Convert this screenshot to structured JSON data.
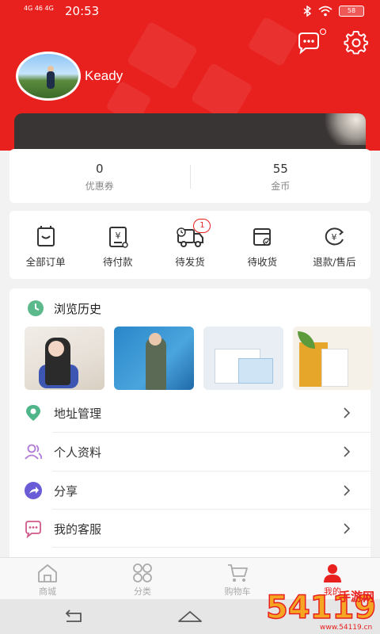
{
  "status_bar": {
    "signal": "4G 46 4G",
    "time": "20:53",
    "battery": "58"
  },
  "profile": {
    "username": "Keady"
  },
  "stats": [
    {
      "value": "0",
      "label": "优惠券"
    },
    {
      "value": "55",
      "label": "金币"
    }
  ],
  "orders": [
    {
      "label": "全部订单",
      "icon": "order-list-icon"
    },
    {
      "label": "待付款",
      "icon": "pending-payment-icon"
    },
    {
      "label": "待发货",
      "icon": "pending-shipment-icon",
      "badge": "1"
    },
    {
      "label": "待收货",
      "icon": "pending-receipt-icon"
    },
    {
      "label": "退款/售后",
      "icon": "refund-icon"
    }
  ],
  "history": {
    "title": "浏览历史"
  },
  "menu": [
    {
      "label": "地址管理",
      "icon": "location-icon"
    },
    {
      "label": "个人资料",
      "icon": "user-profile-icon"
    },
    {
      "label": "分享",
      "icon": "share-icon"
    },
    {
      "label": "我的客服",
      "icon": "customer-service-icon"
    }
  ],
  "tabs": [
    {
      "label": "商城",
      "icon": "home-icon",
      "active": false
    },
    {
      "label": "分类",
      "icon": "category-icon",
      "active": false
    },
    {
      "label": "购物车",
      "icon": "cart-icon",
      "active": false
    },
    {
      "label": "我的",
      "icon": "me-icon",
      "active": true
    }
  ],
  "watermark": {
    "line1": "手游网",
    "line2": "www.54119.cn",
    "number": "54119"
  },
  "colors": {
    "brand": "#e8201e",
    "badge": "#e8201e",
    "tab_inactive": "#aaaaaa"
  }
}
